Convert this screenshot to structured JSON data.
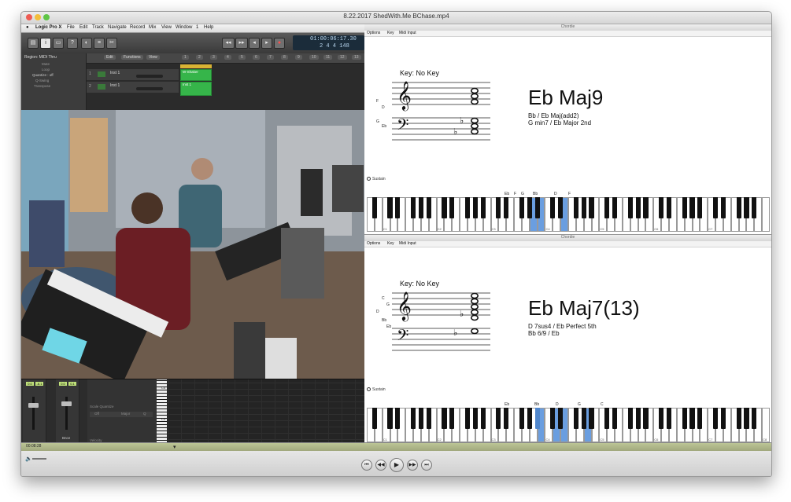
{
  "window": {
    "title": "8.22.2017 ShedWith.Me BChase.mp4"
  },
  "logic": {
    "menu": [
      "Logic Pro X",
      "File",
      "Edit",
      "Track",
      "Navigate",
      "Record",
      "Mix",
      "View",
      "Window",
      "1",
      "Help"
    ],
    "lcd_time": "01:00:06:17.30",
    "lcd_bars": "2  4  4  148",
    "inspector": {
      "region": "Region: MIDI Thru",
      "rows": [
        "Mute",
        "Loop",
        "Quantize : off",
        "Q-Swing",
        "Transpose"
      ]
    },
    "track_toolbar": [
      "Edit",
      "Functions",
      "View"
    ],
    "ruler": [
      "1",
      "2",
      "3",
      "4",
      "5",
      "6",
      "7",
      "8",
      "9",
      "10",
      "11",
      "12",
      "13"
    ],
    "tracks": [
      {
        "num": "1",
        "name": "Inst 1",
        "region": "W-Shaker"
      },
      {
        "num": "2",
        "name": "Inst 1",
        "region": "Inst 1"
      }
    ],
    "mixer": {
      "strips": [
        {
          "name": "Inst 1",
          "meter_l": "0.0",
          "meter_r": "-6.1"
        },
        {
          "name": "Stereo Out",
          "meter_l": "0.0",
          "meter_r": "0.1",
          "extra": "Bnce"
        }
      ],
      "editor_params": {
        "scale_quantize": "Scale Quantize",
        "off": "Off",
        "major": "Major",
        "q": "Q",
        "velocity": "Velocity",
        "vel_val": "80"
      },
      "pianoroll_labels": [
        "C4",
        "C3",
        "C2"
      ]
    }
  },
  "chordie": [
    {
      "title": "Chordie",
      "menu": [
        "Options",
        "Key",
        "Midi Input"
      ],
      "key": "Key: No Key",
      "chord": "Eb Maj9",
      "alternatives": [
        "Bb / Eb Maj(add2)",
        "G min7 / Eb Major 2nd"
      ],
      "staff_notes_left": [
        "F",
        "D",
        "G",
        "Eb"
      ],
      "sustain": "Sustain",
      "note_labels": [
        "Eb",
        "F",
        "G",
        "Bb",
        "D",
        "F"
      ],
      "octave_labels": [
        "C1",
        "C2",
        "C3",
        "C4",
        "C5",
        "C6",
        "C7"
      ],
      "highlighted": [
        19,
        21,
        22,
        24,
        28,
        31
      ]
    },
    {
      "title": "Chordie",
      "menu": [
        "Options",
        "Key",
        "Midi Input"
      ],
      "key": "Key: No Key",
      "chord": "Eb Maj7(13)",
      "alternatives": [
        "D 7sus4 / Eb Perfect 5th",
        "Bb 6/9 / Eb"
      ],
      "staff_notes_left": [
        "C",
        "G",
        "D",
        "Bb",
        "Eb"
      ],
      "sustain": "Sustain",
      "note_labels": [
        "Eb",
        "Bb",
        "D",
        "G",
        "C"
      ],
      "octave_labels": [
        "C1",
        "C2",
        "C3",
        "C4",
        "C5",
        "C6",
        "C7",
        "C8"
      ],
      "highlighted": [
        19,
        22,
        28,
        31,
        35
      ]
    }
  ],
  "player": {
    "time": "00:08:28",
    "buttons": [
      "previous",
      "rewind",
      "play",
      "fast-forward",
      "next"
    ],
    "glyphs": [
      "⏮",
      "◀◀",
      "▶",
      "▶▶",
      "⏭"
    ],
    "volume_icon": "🔈"
  }
}
